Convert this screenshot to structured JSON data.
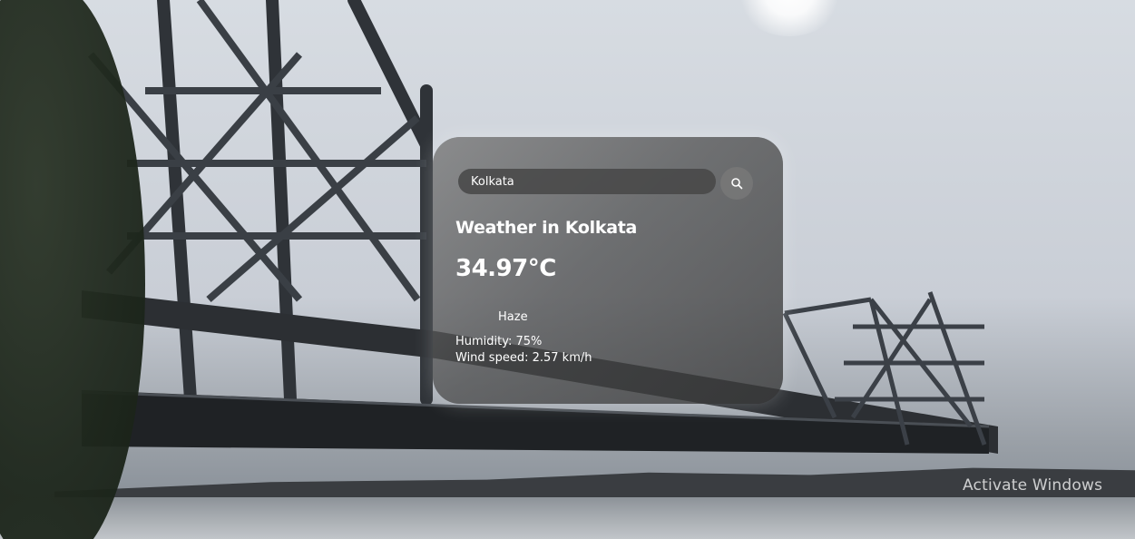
{
  "search": {
    "value": "Kolkata",
    "button_icon": "search-icon"
  },
  "weather": {
    "title": "Weather in Kolkata",
    "temperature": "34.97°C",
    "condition": "Haze",
    "condition_icon": "haze-icon",
    "humidity": "Humidity: 75%",
    "wind": "Wind speed: 2.57 km/h"
  },
  "watermark": {
    "text": "Activate Windows"
  }
}
